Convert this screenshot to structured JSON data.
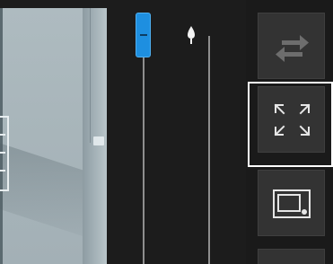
{
  "preview": {
    "icon": "image-preview"
  },
  "sliders": {
    "primary": {
      "icon": "slider-thumb",
      "color": "#1e8fe0"
    },
    "secondary": {
      "icon": "drop-icon"
    }
  },
  "toolbar": {
    "buttons": [
      {
        "icon": "swap-arrows-icon",
        "selected": false,
        "enabled": false
      },
      {
        "icon": "fit-screen-icon",
        "selected": true,
        "enabled": true
      },
      {
        "icon": "frame-icon",
        "selected": false,
        "enabled": true
      },
      {
        "icon": "more-icon",
        "selected": false,
        "enabled": true
      }
    ]
  },
  "colors": {
    "accent": "#1e8fe0",
    "panel": "#1c1c1c",
    "button": "#333333",
    "selection": "#ffffff"
  }
}
